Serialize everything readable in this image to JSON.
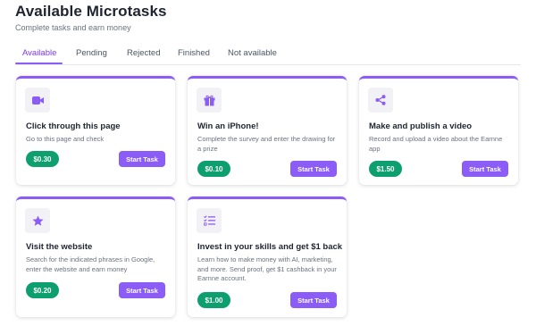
{
  "header": {
    "title": "Available Microtasks",
    "subtitle": "Complete tasks and earn money"
  },
  "tabs": [
    {
      "label": "Available",
      "active": true
    },
    {
      "label": "Pending",
      "active": false
    },
    {
      "label": "Rejected",
      "active": false
    },
    {
      "label": "Finished",
      "active": false
    },
    {
      "label": "Not available",
      "active": false
    }
  ],
  "colors": {
    "accent": "#8b5cf6",
    "reward": "#0e9f6e",
    "icon_bg": "#f1f1f6"
  },
  "tasks": [
    {
      "icon": "video-camera-icon",
      "title": "Click through this page",
      "description": "Go to this page and check",
      "reward": "$0.30",
      "button": "Start Task"
    },
    {
      "icon": "gift-icon",
      "title": "Win an iPhone!",
      "description": "Complete the survey and enter the drawing for a prize",
      "reward": "$0.10",
      "button": "Start Task"
    },
    {
      "icon": "share-icon",
      "title": "Make and publish a video",
      "description": "Record and upload a video about the Earnne app",
      "reward": "$1.50",
      "button": "Start Task"
    },
    {
      "icon": "star-icon",
      "title": "Visit the website",
      "description": "Search for the indicated phrases in Google, enter the website and earn money",
      "reward": "$0.20",
      "button": "Start Task"
    },
    {
      "icon": "checklist-icon",
      "title": "Invest in your skills and get $1 back",
      "description": "Learn how to make money with AI, marketing, and more. Send proof, get $1 cashback in your Earnne account.",
      "reward": "$1.00",
      "button": "Start Task"
    }
  ]
}
